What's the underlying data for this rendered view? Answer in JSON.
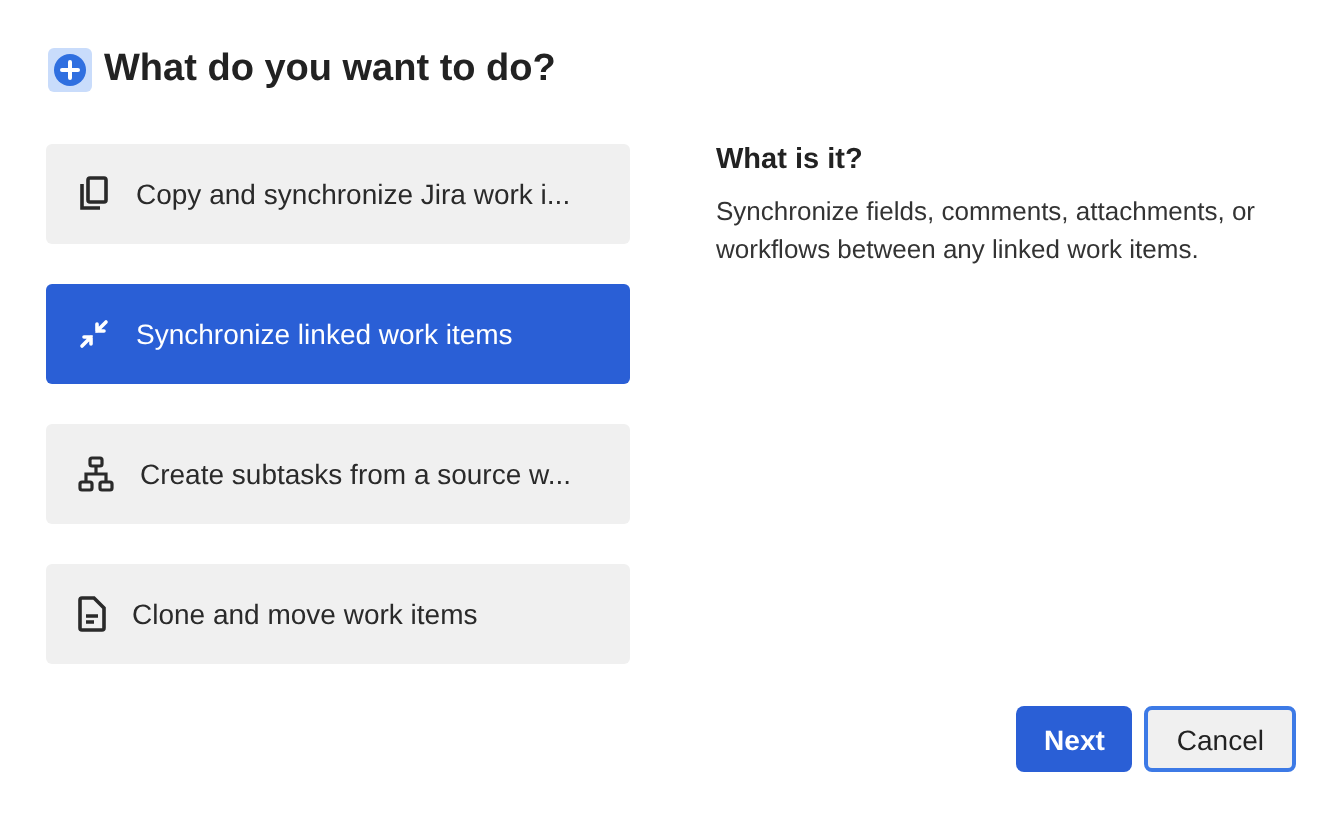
{
  "heading": {
    "title": "What do you want to do?"
  },
  "options": [
    {
      "label": "Copy and synchronize Jira work i...",
      "selected": false
    },
    {
      "label": "Synchronize linked work items",
      "selected": true
    },
    {
      "label": "Create subtasks from a source w...",
      "selected": false
    },
    {
      "label": "Clone and move work items",
      "selected": false
    }
  ],
  "info": {
    "title": "What is it?",
    "description": "Synchronize fields, comments, attachments, or workflows between any linked work items."
  },
  "buttons": [
    {
      "label": "Next",
      "kind": "primary",
      "focused": false
    },
    {
      "label": "Cancel",
      "kind": "secondary",
      "focused": true
    }
  ]
}
